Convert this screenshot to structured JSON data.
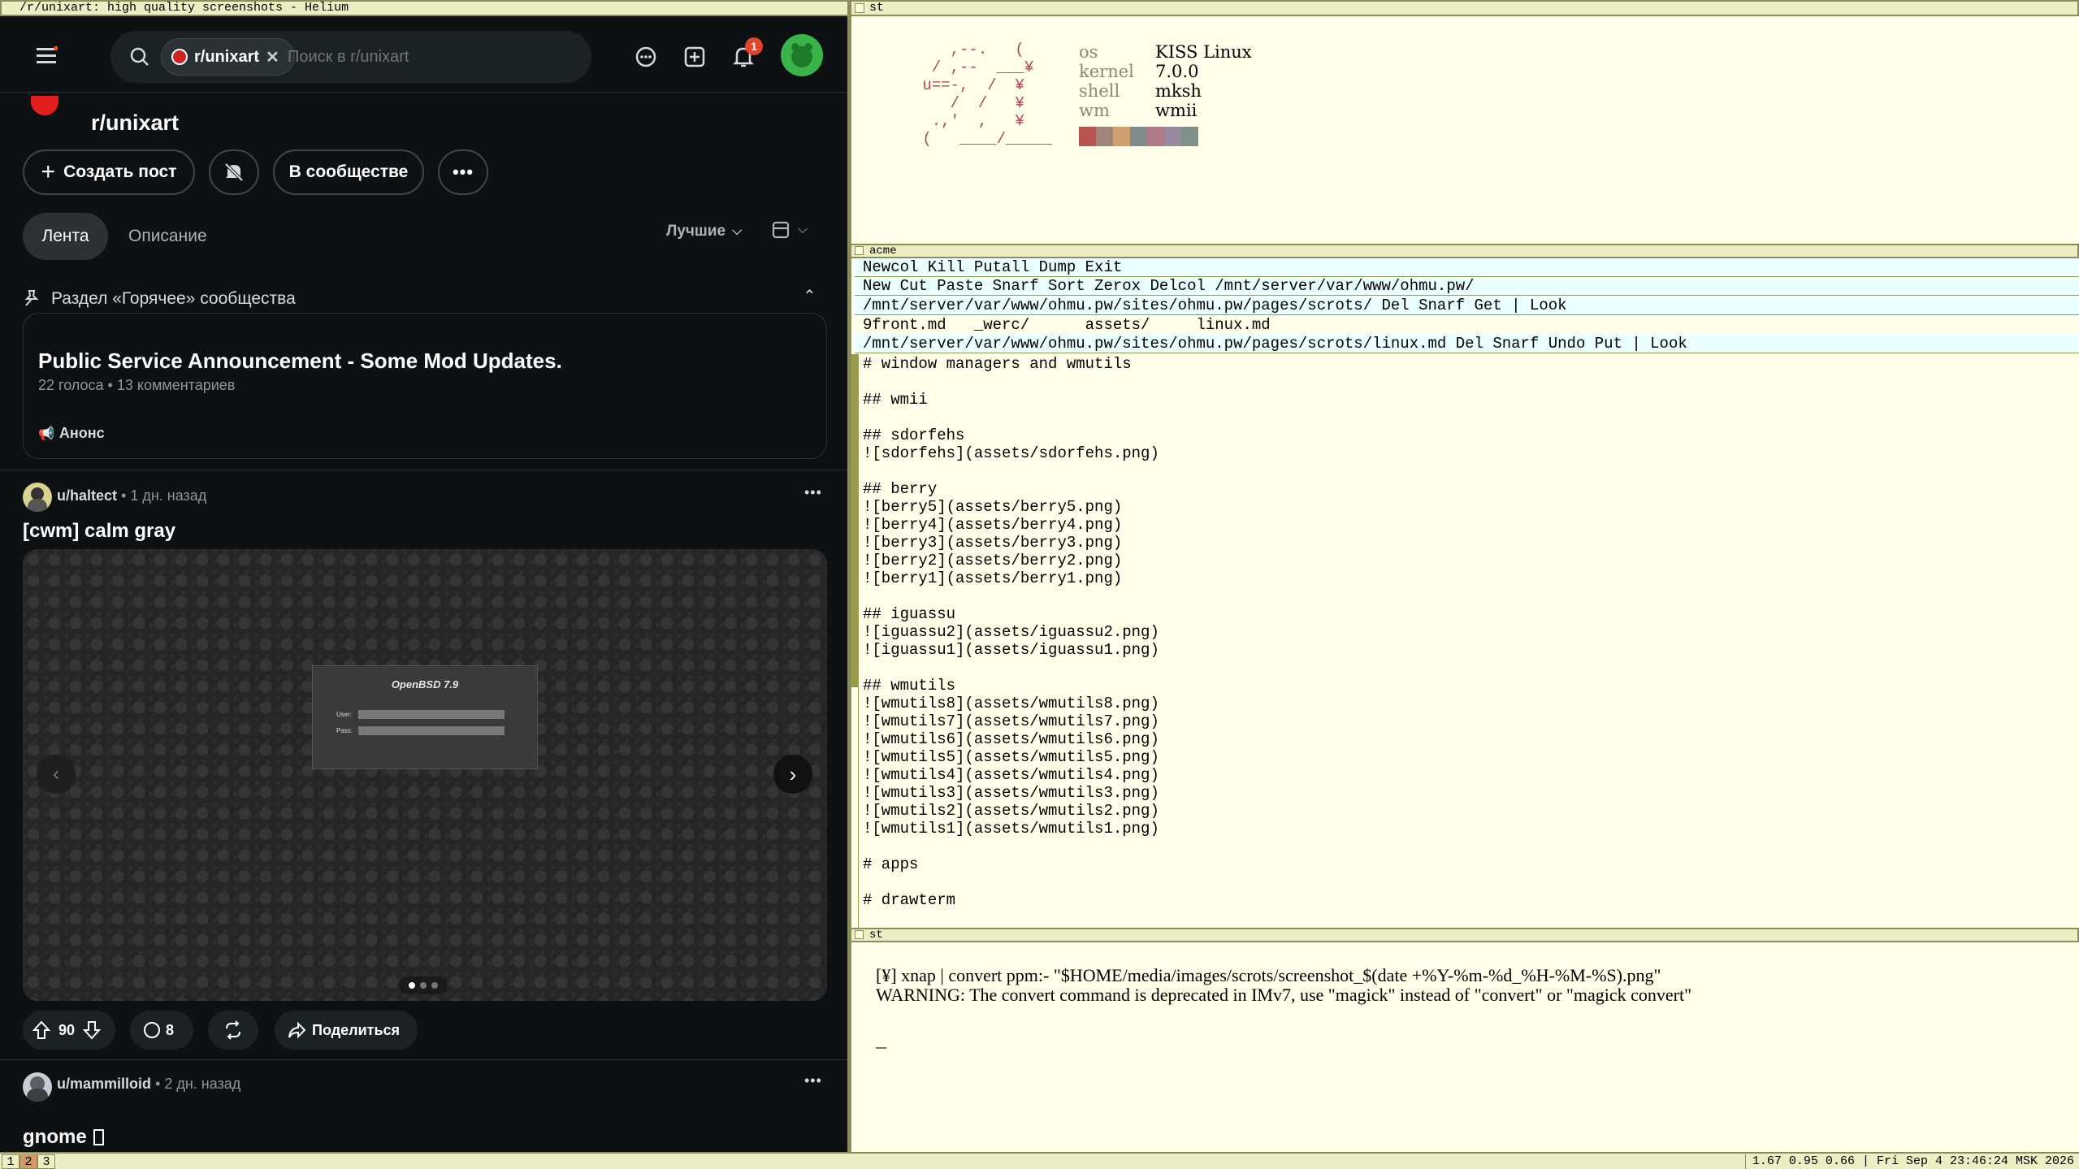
{
  "left_window_title": "/r/unixart: high quality screenshots - Helium",
  "reddit": {
    "search_chip": "r/unixart",
    "search_placeholder": "Поиск в r/unixart",
    "notif_count": "1",
    "subreddit": "r/unixart",
    "create_post": "Создать пост",
    "joined": "В сообществе",
    "tabs": {
      "feed": "Лента",
      "about": "Описание"
    },
    "sort": "Лучшие",
    "hot_section": "Раздел «Горячее» сообщества",
    "pinned": {
      "title": "Public Service Announcement - Some Mod Updates.",
      "meta": "22 голоса • 13 комментариев",
      "tag": "Анонс"
    },
    "post1": {
      "user": "u/haltect",
      "time": "• 1 дн. назад",
      "title": "[cwm] calm gray",
      "image_title": "OpenBSD 7.9",
      "image_user": "User:",
      "image_pass": "Pass:",
      "votes": "90",
      "comments": "8",
      "share": "Поделиться"
    },
    "post2": {
      "user": "u/mammilloid",
      "time": "• 2 дн. назад",
      "title": "gnome"
    }
  },
  "term1": {
    "title": "st",
    "fetch": [
      {
        "k": "os",
        "v": "KISS Linux"
      },
      {
        "k": "kernel",
        "v": "7.0.0"
      },
      {
        "k": "shell",
        "v": "mksh"
      },
      {
        "k": "wm",
        "v": "wmii"
      }
    ],
    "ascii_art": "    ,--.   (\n  / ,--  ___¥\n u==-,  /  ¥\n    /  /   ¥\n  .,'  ,   ¥\n (   ____/_____",
    "palette": [
      "#b85450",
      "#a0867a",
      "#d1a070",
      "#7f8c8d",
      "#b07a86",
      "#9a8aa0",
      "#7d9188"
    ]
  },
  "acme": {
    "title": "acme",
    "tag_main": "Newcol Kill Putall Dump Exit",
    "tag_col": "New Cut Paste Snarf Sort Zerox Delcol /mnt/server/var/www/ohmu.pw/",
    "tag_dir": "/mnt/server/var/www/ohmu.pw/sites/ohmu.pw/pages/scrots/ Del Snarf Get | Look ",
    "dir_listing": "9front.md   _werc/      assets/     linux.md",
    "tag_file": "/mnt/server/var/www/ohmu.pw/sites/ohmu.pw/pages/scrots/linux.md Del Snarf Undo Put | Look",
    "body_lines": [
      "# window managers and wmutils",
      "",
      "## wmii",
      "",
      "## sdorfehs",
      "![sdorfehs](assets/sdorfehs.png)",
      "",
      "## berry",
      "![berry5](assets/berry5.png)",
      "![berry4](assets/berry4.png)",
      "![berry3](assets/berry3.png)",
      "![berry2](assets/berry2.png)",
      "![berry1](assets/berry1.png)",
      "",
      "## iguassu",
      "![iguassu2](assets/iguassu2.png)",
      "![iguassu1](assets/iguassu1.png)",
      "",
      "## wmutils",
      "![wmutils8](assets/wmutils8.png)",
      "![wmutils7](assets/wmutils7.png)",
      "![wmutils6](assets/wmutils6.png)",
      "![wmutils5](assets/wmutils5.png)",
      "![wmutils4](assets/wmutils4.png)",
      "![wmutils3](assets/wmutils3.png)",
      "![wmutils2](assets/wmutils2.png)",
      "![wmutils1](assets/wmutils1.png)",
      "",
      "# apps",
      "",
      "# drawterm"
    ]
  },
  "term2": {
    "title": "st",
    "line1": "[¥] xnap | convert ppm:- \"$HOME/media/images/scrots/screenshot_$(date +%Y-%m-%d_%H-%M-%S).png\"",
    "line2": "WARNING: The convert command is deprecated in IMv7, use \"magick\" instead of \"convert\" or \"magick convert\"",
    "prompt": "_"
  },
  "statusbar": {
    "tags": [
      "1",
      "2",
      "3"
    ],
    "status": "1.67 0.95 0.66 | Fri Sep 4 23:46:24 MSK 2026"
  }
}
